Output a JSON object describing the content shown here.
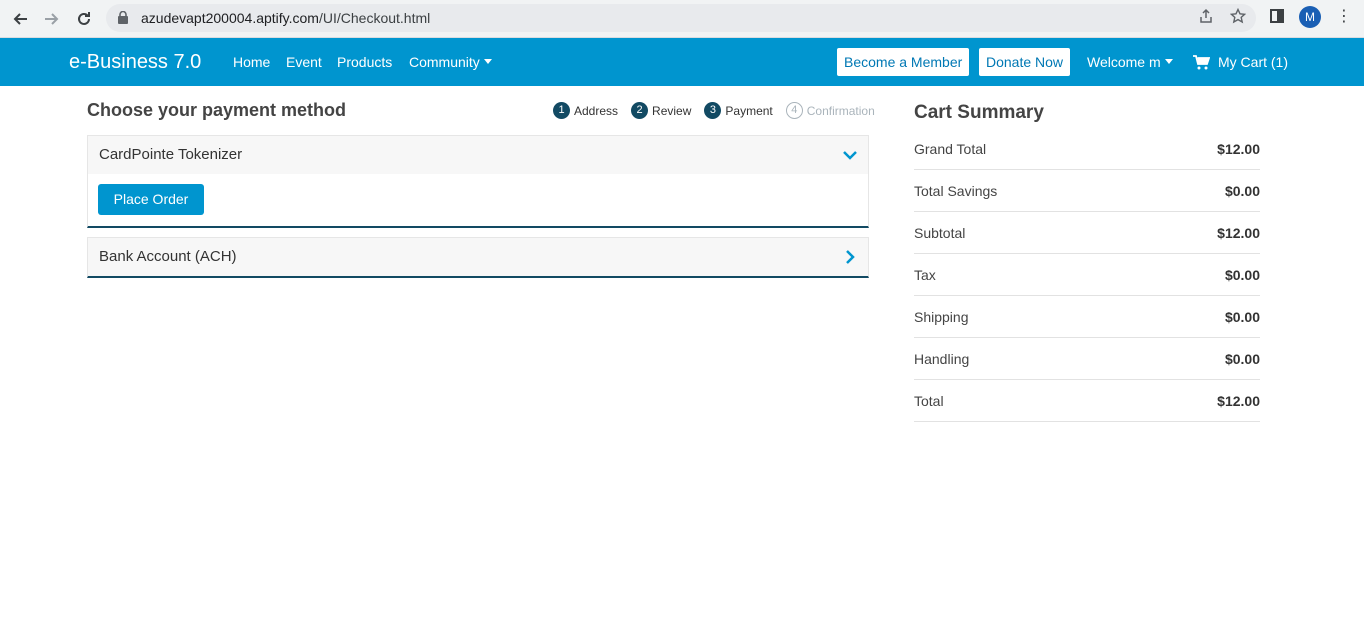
{
  "browser": {
    "url_host": "azudevapt200004.aptify.com",
    "url_path": "/UI/Checkout.html",
    "profile_initial": "M"
  },
  "navbar": {
    "brand": "e-Business 7.0",
    "links": [
      "Home",
      "Event",
      "Products",
      "Community"
    ],
    "become_member": "Become a Member",
    "donate_now": "Donate Now",
    "welcome": "Welcome m",
    "cart": "My Cart (1)",
    "bg_color": "#0095cf"
  },
  "checkout": {
    "title": "Choose your payment method",
    "steps": [
      {
        "num": "1",
        "label": "Address"
      },
      {
        "num": "2",
        "label": "Review"
      },
      {
        "num": "3",
        "label": "Payment"
      },
      {
        "num": "4",
        "label": "Confirmation"
      }
    ],
    "panels": [
      {
        "title": "CardPointe Tokenizer",
        "expanded": true,
        "button": "Place Order"
      },
      {
        "title": "Bank Account (ACH)",
        "expanded": false
      }
    ]
  },
  "summary": {
    "title": "Cart Summary",
    "rows": [
      {
        "label": "Grand Total",
        "value": "$12.00"
      },
      {
        "label": "Total Savings",
        "value": "$0.00"
      },
      {
        "label": "Subtotal",
        "value": "$12.00"
      },
      {
        "label": "Tax",
        "value": "$0.00"
      },
      {
        "label": "Shipping",
        "value": "$0.00"
      },
      {
        "label": "Handling",
        "value": "$0.00"
      },
      {
        "label": "Total",
        "value": "$12.00"
      }
    ]
  }
}
